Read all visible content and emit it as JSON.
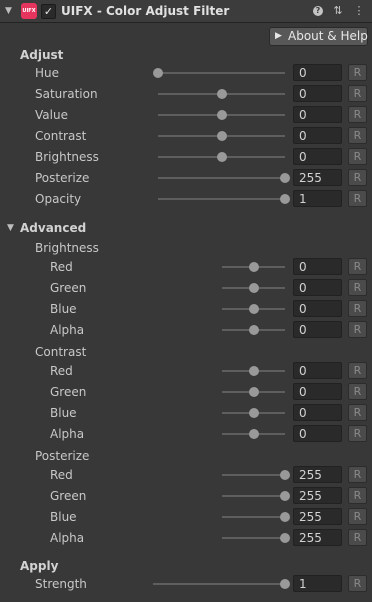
{
  "header": {
    "fold_glyph": "▼",
    "logo_text": "UIFX",
    "enabled_mark": "✓",
    "title": "UIFX - Color Adjust Filter",
    "help_glyph": "?",
    "settings_glyph": "⇅",
    "menu_glyph": "⋮"
  },
  "toolbar": {
    "about_glyph": "▶",
    "about_label": "About & Help"
  },
  "reset_label": "R",
  "sections": {
    "adjust": "Adjust",
    "advanced": "Advanced",
    "advanced_fold": "▼",
    "apply": "Apply",
    "brightness": "Brightness",
    "contrast": "Contrast",
    "posterize": "Posterize"
  },
  "adjust_rows": [
    {
      "label": "Hue",
      "value": "0"
    },
    {
      "label": "Saturation",
      "value": "0"
    },
    {
      "label": "Value",
      "value": "0"
    },
    {
      "label": "Contrast",
      "value": "0"
    },
    {
      "label": "Brightness",
      "value": "0"
    },
    {
      "label": "Posterize",
      "value": "255"
    },
    {
      "label": "Opacity",
      "value": "1"
    }
  ],
  "brightness_rows": [
    {
      "label": "Red",
      "value": "0"
    },
    {
      "label": "Green",
      "value": "0"
    },
    {
      "label": "Blue",
      "value": "0"
    },
    {
      "label": "Alpha",
      "value": "0"
    }
  ],
  "contrast_rows": [
    {
      "label": "Red",
      "value": "0"
    },
    {
      "label": "Green",
      "value": "0"
    },
    {
      "label": "Blue",
      "value": "0"
    },
    {
      "label": "Alpha",
      "value": "0"
    }
  ],
  "posterize_rows": [
    {
      "label": "Red",
      "value": "255"
    },
    {
      "label": "Green",
      "value": "255"
    },
    {
      "label": "Blue",
      "value": "255"
    },
    {
      "label": "Alpha",
      "value": "255"
    }
  ],
  "apply_rows": [
    {
      "label": "Strength",
      "value": "1"
    }
  ],
  "slider_levels": {
    "adjust_rows": [
      0.0,
      0.5,
      0.5,
      0.5,
      0.5,
      1.0,
      1.0
    ],
    "brightness_rows": [
      0.5,
      0.5,
      0.5,
      0.5
    ],
    "contrast_rows": [
      0.5,
      0.5,
      0.5,
      0.5
    ],
    "posterize_rows": [
      1.0,
      1.0,
      1.0,
      1.0
    ],
    "apply_rows": [
      1.0
    ]
  },
  "colors": {
    "background": "#383838",
    "field": "#2a2a2a",
    "logo": "#e5355f",
    "track": "#5e5e5e",
    "thumb": "#999999"
  }
}
